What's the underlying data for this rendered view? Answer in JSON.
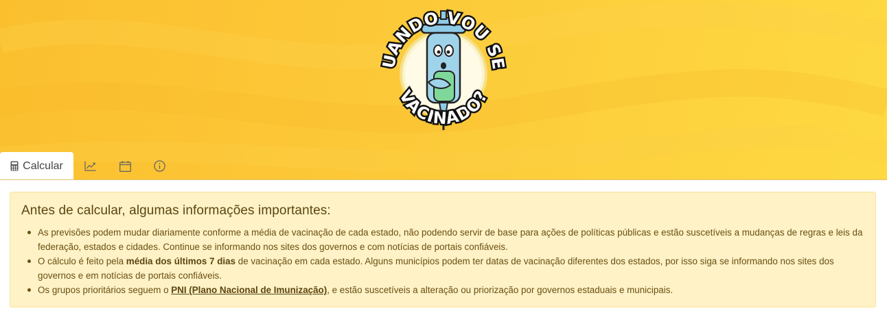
{
  "logo": {
    "top_text": "QUANDO VOU SER",
    "bottom_text": "VACINADO?"
  },
  "tabs": [
    {
      "label": "Calcular",
      "icon": "calculator-icon",
      "active": true
    },
    {
      "label": "",
      "icon": "chart-line-icon",
      "active": false
    },
    {
      "label": "",
      "icon": "calendar-icon",
      "active": false
    },
    {
      "label": "",
      "icon": "info-circle-icon",
      "active": false
    }
  ],
  "alert": {
    "title": "Antes de calcular, algumas informações importantes:",
    "items": [
      {
        "text": "As previsões podem mudar diariamente conforme a média de vacinação de cada estado, não podendo servir de base para ações de políticas públicas e estão suscetíveis a mudanças de regras e leis da federação, estados e cidades. Continue se informando nos sites dos governos e com notícias de portais confiáveis."
      },
      {
        "before": "O cálculo é feito pela ",
        "bold": "média dos últimos 7 dias",
        "after": " de vacinação em cada estado. Alguns municípios podem ter datas de vacinação diferentes dos estados, por isso siga se informando nos sites dos governos e em notícias de portais confiáveis."
      },
      {
        "before": "Os grupos prioritários seguem o ",
        "link": "PNI (Plano Nacional de Imunização)",
        "after": ", e estão suscetíveis a alteração ou priorização por governos estaduais e municipais."
      }
    ]
  },
  "colors": {
    "hero_start": "#fbbf2e",
    "hero_end": "#fed940",
    "alert_bg": "#fef2c6",
    "alert_text": "#6b4f12"
  }
}
